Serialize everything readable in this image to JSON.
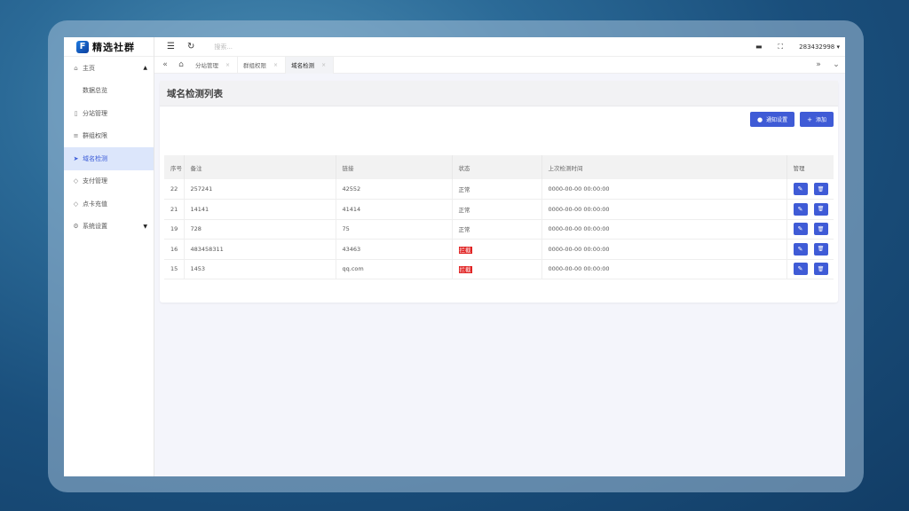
{
  "brand": {
    "logo_letter": "F",
    "name": "精选社群"
  },
  "sidebar": {
    "items": [
      {
        "label": "主页",
        "icon": "home-icon",
        "glyph": "⌂",
        "caret": "▲"
      },
      {
        "label": "数据总览",
        "sub": true
      },
      {
        "label": "分站管理",
        "icon": "grid-icon",
        "glyph": "▯"
      },
      {
        "label": "群组权限",
        "icon": "sliders-icon",
        "glyph": "≡"
      },
      {
        "label": "域名检测",
        "icon": "send-icon",
        "glyph": "➤",
        "active": true
      },
      {
        "label": "支付管理",
        "icon": "shield-icon",
        "glyph": "◇"
      },
      {
        "label": "点卡充值",
        "icon": "shield-check-icon",
        "glyph": "◇"
      },
      {
        "label": "系统设置",
        "icon": "gear-icon",
        "glyph": "⚙",
        "caret": "▼"
      }
    ]
  },
  "header": {
    "search_placeholder": "搜索...",
    "user": "283432998"
  },
  "tabs": [
    {
      "label": "分站管理"
    },
    {
      "label": "群组权限"
    },
    {
      "label": "域名检测",
      "active": true
    }
  ],
  "main": {
    "title": "域名检测列表",
    "notify_button": "通知设置",
    "add_button": "添加",
    "columns": [
      "序号",
      "备注",
      "链接",
      "状态",
      "上次检测时间",
      "管理"
    ],
    "rows": [
      {
        "id": "22",
        "note": "257241",
        "link": "42552",
        "status": "正常",
        "bad": false,
        "time": "0000-00-00 00:00:00"
      },
      {
        "id": "21",
        "note": "14141",
        "link": "41414",
        "status": "正常",
        "bad": false,
        "time": "0000-00-00 00:00:00"
      },
      {
        "id": "19",
        "note": "728",
        "link": "75",
        "status": "正常",
        "bad": false,
        "time": "0000-00-00 00:00:00"
      },
      {
        "id": "16",
        "note": "483458311",
        "link": "43463",
        "status": "拦截",
        "bad": true,
        "time": "0000-00-00 00:00:00"
      },
      {
        "id": "15",
        "note": "1453",
        "link": "qq.com",
        "status": "拦截",
        "bad": true,
        "time": "0000-00-00 00:00:00"
      }
    ]
  },
  "colors": {
    "accent": "#3f5bd6",
    "danger": "#e02020",
    "active_bg": "#dce6fb"
  }
}
